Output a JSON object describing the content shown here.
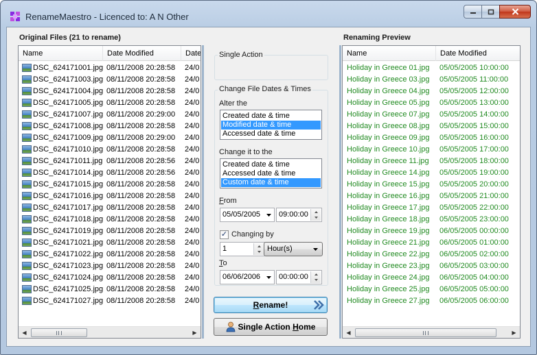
{
  "window": {
    "title": "RenameMaestro - Licenced to: A N Other",
    "minimize_label": "minimize",
    "maximize_label": "maximize",
    "close_label": "close"
  },
  "original": {
    "title": "Original Files (21 to rename)",
    "columns": [
      "Name",
      "Date Modified",
      "Date"
    ],
    "rows": [
      {
        "name": "DSC_624171001.jpg",
        "modified": "08/11/2008 20:28:58",
        "extra": "24/0"
      },
      {
        "name": "DSC_624171003.jpg",
        "modified": "08/11/2008 20:28:58",
        "extra": "24/0"
      },
      {
        "name": "DSC_624171004.jpg",
        "modified": "08/11/2008 20:28:58",
        "extra": "24/0"
      },
      {
        "name": "DSC_624171005.jpg",
        "modified": "08/11/2008 20:28:58",
        "extra": "24/0"
      },
      {
        "name": "DSC_624171007.jpg",
        "modified": "08/11/2008 20:29:00",
        "extra": "24/0"
      },
      {
        "name": "DSC_624171008.jpg",
        "modified": "08/11/2008 20:28:58",
        "extra": "24/0"
      },
      {
        "name": "DSC_624171009.jpg",
        "modified": "08/11/2008 20:29:00",
        "extra": "24/0"
      },
      {
        "name": "DSC_624171010.jpg",
        "modified": "08/11/2008 20:28:58",
        "extra": "24/0"
      },
      {
        "name": "DSC_624171011.jpg",
        "modified": "08/11/2008 20:28:56",
        "extra": "24/0"
      },
      {
        "name": "DSC_624171014.jpg",
        "modified": "08/11/2008 20:28:56",
        "extra": "24/0"
      },
      {
        "name": "DSC_624171015.jpg",
        "modified": "08/11/2008 20:28:58",
        "extra": "24/0"
      },
      {
        "name": "DSC_624171016.jpg",
        "modified": "08/11/2008 20:28:58",
        "extra": "24/0"
      },
      {
        "name": "DSC_624171017.jpg",
        "modified": "08/11/2008 20:28:58",
        "extra": "24/0"
      },
      {
        "name": "DSC_624171018.jpg",
        "modified": "08/11/2008 20:28:58",
        "extra": "24/0"
      },
      {
        "name": "DSC_624171019.jpg",
        "modified": "08/11/2008 20:28:58",
        "extra": "24/0"
      },
      {
        "name": "DSC_624171021.jpg",
        "modified": "08/11/2008 20:28:58",
        "extra": "24/0"
      },
      {
        "name": "DSC_624171022.jpg",
        "modified": "08/11/2008 20:28:58",
        "extra": "24/0"
      },
      {
        "name": "DSC_624171023.jpg",
        "modified": "08/11/2008 20:28:58",
        "extra": "24/0"
      },
      {
        "name": "DSC_624171024.jpg",
        "modified": "08/11/2008 20:28:58",
        "extra": "24/0"
      },
      {
        "name": "DSC_624171025.jpg",
        "modified": "08/11/2008 20:28:58",
        "extra": "24/0"
      },
      {
        "name": "DSC_624171027.jpg",
        "modified": "08/11/2008 20:28:58",
        "extra": "24/0"
      }
    ]
  },
  "middle": {
    "single_action_label": "Single Action",
    "change_dates_label": "Change File Dates & Times",
    "alter_label": "Alter the",
    "alter_options": [
      {
        "label": "Created date & time",
        "selected": false
      },
      {
        "label": "Modified date & time",
        "selected": true
      },
      {
        "label": "Accessed date & time",
        "selected": false
      }
    ],
    "change_to_label": "Change it to the",
    "change_to_options": [
      {
        "label": "Created date & time",
        "selected": false
      },
      {
        "label": "Accessed date & time",
        "selected": false
      },
      {
        "label": "Custom date & time",
        "selected": true
      }
    ],
    "from_label_ul": "F",
    "from_label_rest": "rom",
    "from_date": "05/05/2005",
    "from_time": "09:00:00",
    "changing_by_label": "Changing by",
    "changing_by_checked": true,
    "changing_by_amount": "1",
    "changing_by_unit": "Hour(s)",
    "to_label_ul": "T",
    "to_label_rest": "o",
    "to_date": "06/06/2006",
    "to_time": "00:00:00",
    "rename_button_ul": "R",
    "rename_button_rest": "ename!",
    "home_button_pre": "Single Action ",
    "home_button_ul": "H",
    "home_button_rest": "ome"
  },
  "preview": {
    "title": "Renaming Preview",
    "columns": [
      "Name",
      "Date Modified"
    ],
    "rows": [
      {
        "name": "Holiday in Greece 01.jpg",
        "modified": "05/05/2005 10:00:00"
      },
      {
        "name": "Holiday in Greece 03.jpg",
        "modified": "05/05/2005 11:00:00"
      },
      {
        "name": "Holiday in Greece 04.jpg",
        "modified": "05/05/2005 12:00:00"
      },
      {
        "name": "Holiday in Greece 05.jpg",
        "modified": "05/05/2005 13:00:00"
      },
      {
        "name": "Holiday in Greece 07.jpg",
        "modified": "05/05/2005 14:00:00"
      },
      {
        "name": "Holiday in Greece 08.jpg",
        "modified": "05/05/2005 15:00:00"
      },
      {
        "name": "Holiday in Greece 09.jpg",
        "modified": "05/05/2005 16:00:00"
      },
      {
        "name": "Holiday in Greece 10.jpg",
        "modified": "05/05/2005 17:00:00"
      },
      {
        "name": "Holiday in Greece 11.jpg",
        "modified": "05/05/2005 18:00:00"
      },
      {
        "name": "Holiday in Greece 14.jpg",
        "modified": "05/05/2005 19:00:00"
      },
      {
        "name": "Holiday in Greece 15.jpg",
        "modified": "05/05/2005 20:00:00"
      },
      {
        "name": "Holiday in Greece 16.jpg",
        "modified": "05/05/2005 21:00:00"
      },
      {
        "name": "Holiday in Greece 17.jpg",
        "modified": "05/05/2005 22:00:00"
      },
      {
        "name": "Holiday in Greece 18.jpg",
        "modified": "05/05/2005 23:00:00"
      },
      {
        "name": "Holiday in Greece 19.jpg",
        "modified": "06/05/2005 00:00:00"
      },
      {
        "name": "Holiday in Greece 21.jpg",
        "modified": "06/05/2005 01:00:00"
      },
      {
        "name": "Holiday in Greece 22.jpg",
        "modified": "06/05/2005 02:00:00"
      },
      {
        "name": "Holiday in Greece 23.jpg",
        "modified": "06/05/2005 03:00:00"
      },
      {
        "name": "Holiday in Greece 24.jpg",
        "modified": "06/05/2005 04:00:00"
      },
      {
        "name": "Holiday in Greece 25.jpg",
        "modified": "06/05/2005 05:00:00"
      },
      {
        "name": "Holiday in Greece 27.jpg",
        "modified": "06/05/2005 06:00:00"
      }
    ]
  },
  "colors": {
    "selection": "#3399ff",
    "preview_text": "#208a20",
    "titlebar": "#b9cde4"
  }
}
